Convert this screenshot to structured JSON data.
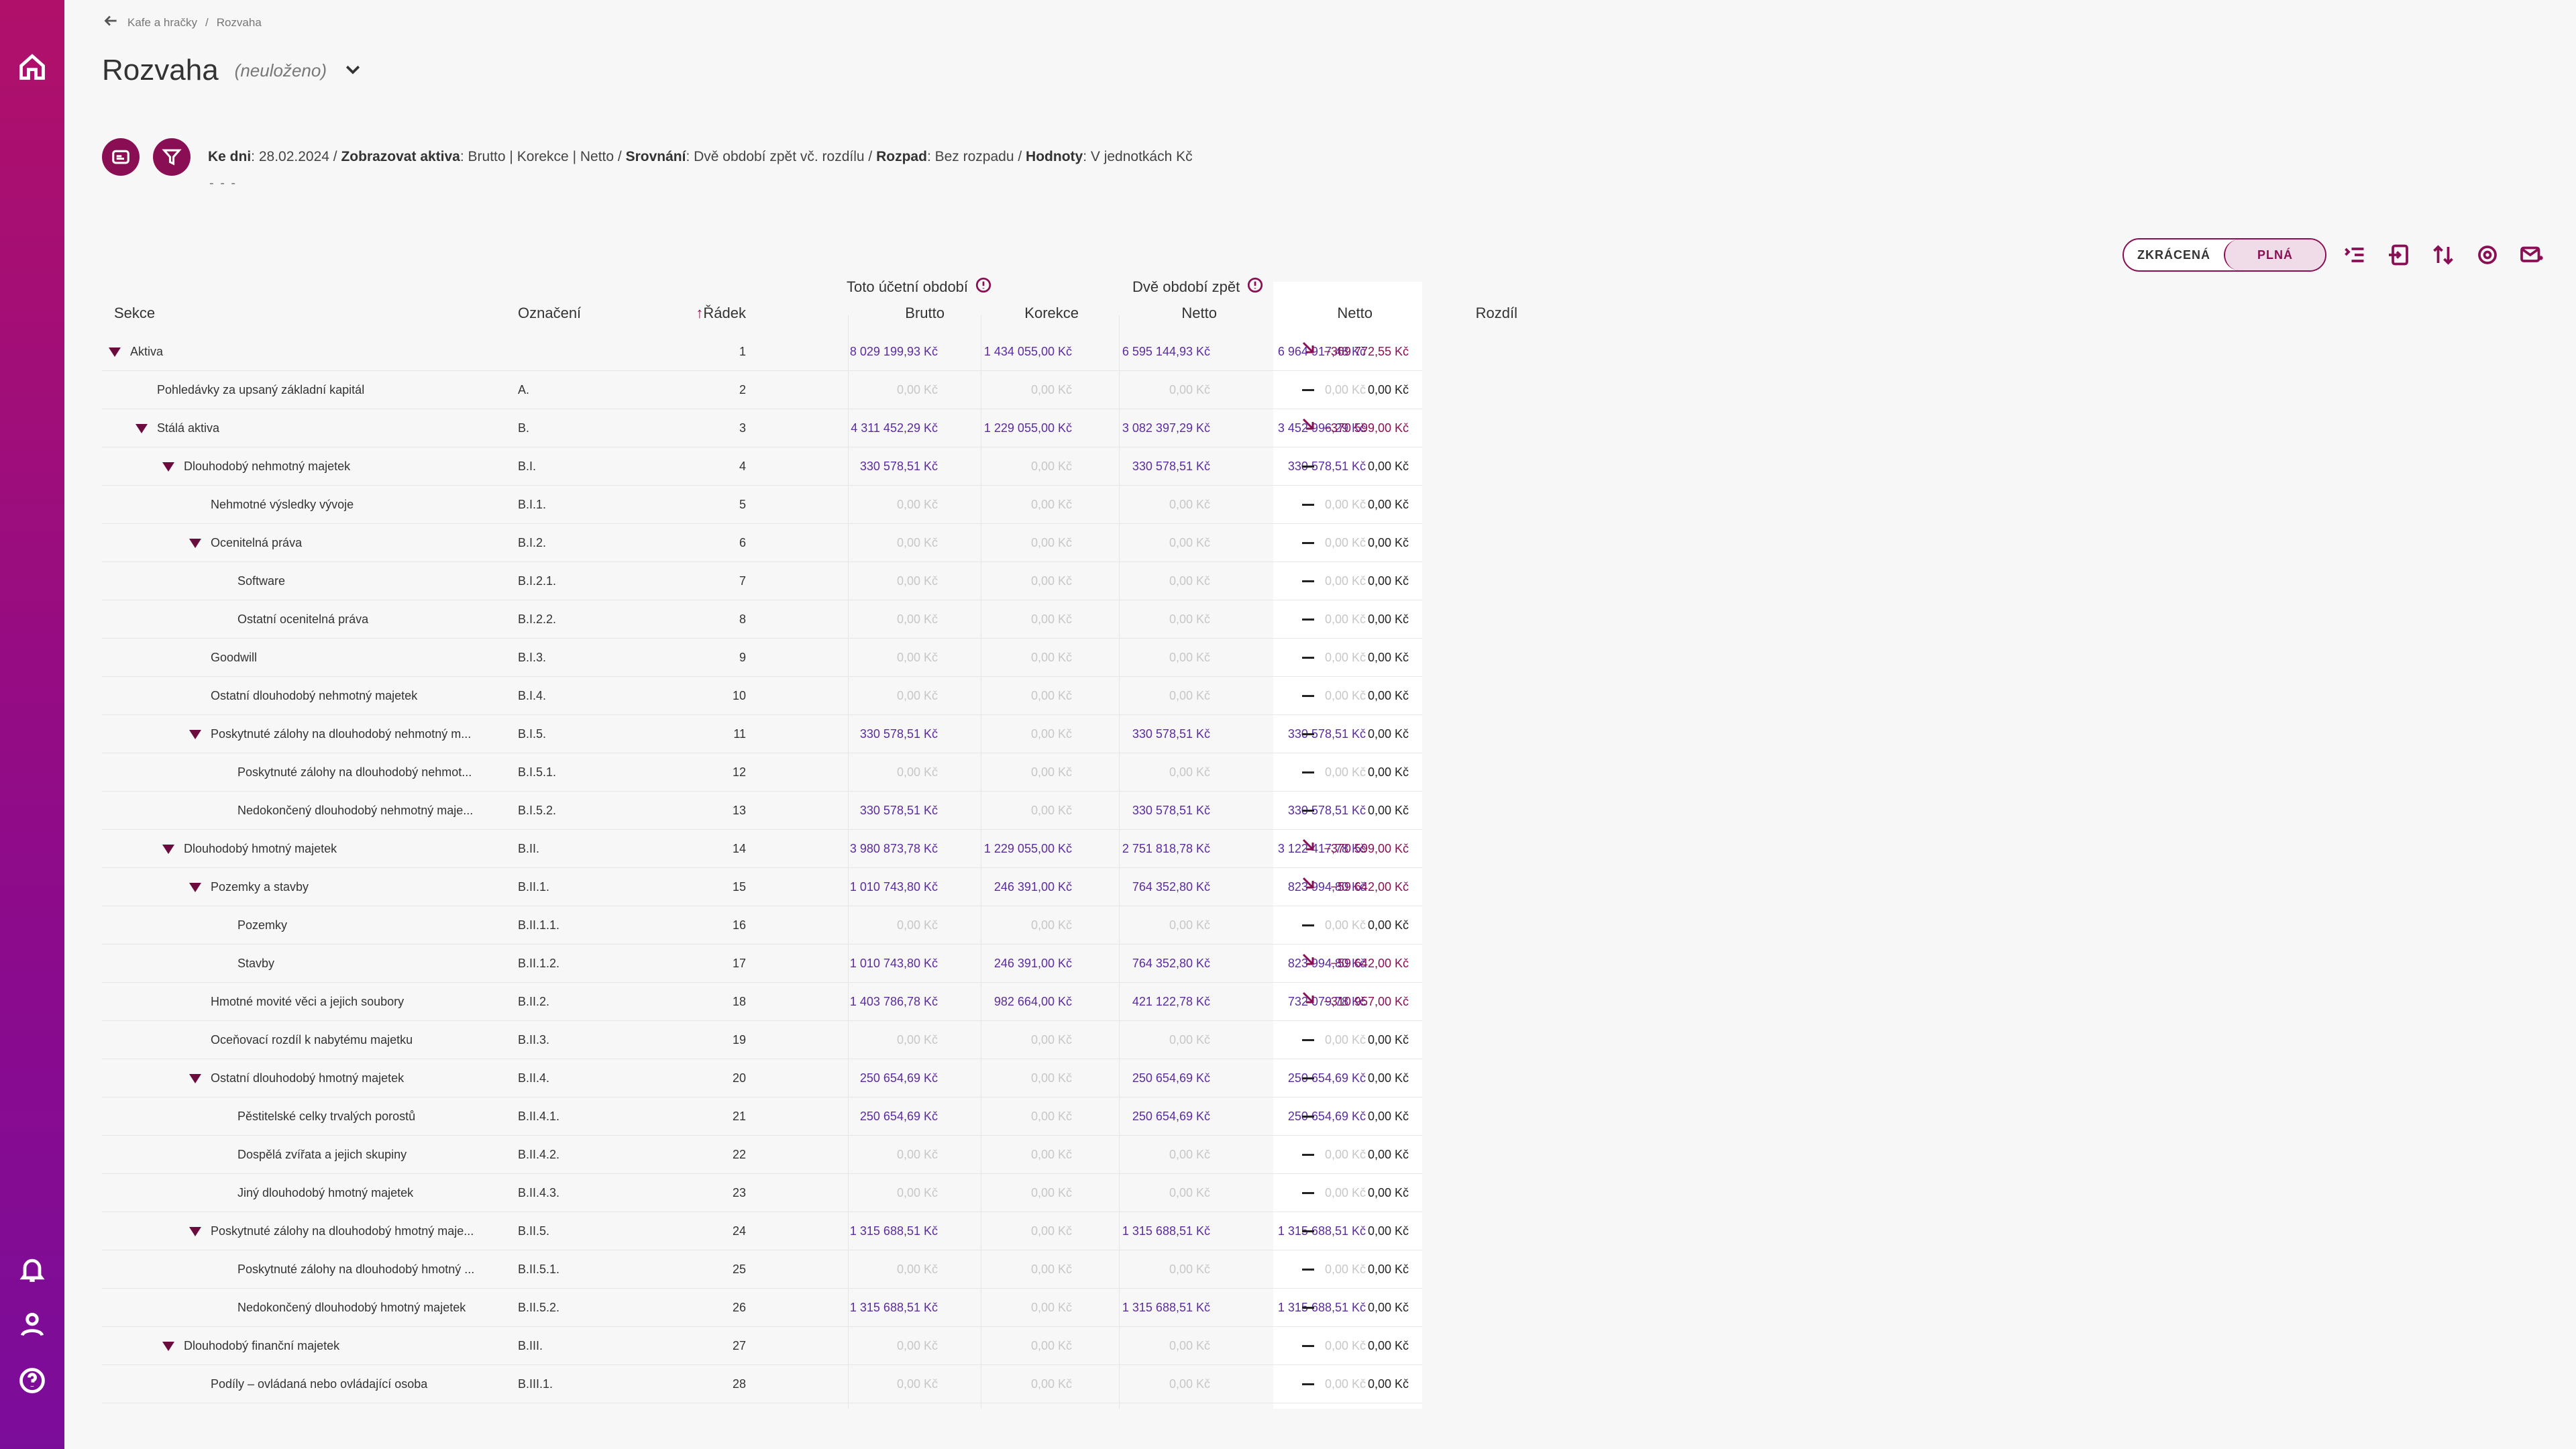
{
  "breadcrumb": {
    "company": "Kafe a hračky",
    "separator": "/",
    "page": "Rozvaha"
  },
  "title": "Rozvaha",
  "subtitle": "(neuloženo)",
  "filters": {
    "ke_dni_label": "Ke dni",
    "ke_dni_value": "28.02.2024",
    "zobrazovat_label": "Zobrazovat aktiva",
    "zobrazovat_value": "Brutto | Korekce | Netto",
    "srovnani_label": "Srovnání",
    "srovnani_value": "Dvě období zpět vč. rozdílu",
    "rozpad_label": "Rozpad",
    "rozpad_value": "Bez rozpadu",
    "hodnoty_label": "Hodnoty",
    "hodnoty_value": "V jednotkách Kč",
    "placeholder": "- - -"
  },
  "view_toggle": {
    "short": "ZKRÁCENÁ",
    "full": "PLNÁ",
    "selected": "full"
  },
  "group_headers": {
    "current": "Toto účetní období",
    "previous": "Dvě období zpět"
  },
  "columns": {
    "sekce": "Sekce",
    "oznaceni": "Označení",
    "radek": "Řádek",
    "brutto": "Brutto",
    "korekce": "Korekce",
    "netto": "Netto",
    "netto_prev": "Netto",
    "rozdil": "Rozdíl"
  },
  "colors": {
    "brand": "#8a0e54",
    "value": "#5b2ba0",
    "zero": "#c7c7c7"
  },
  "rows": [
    {
      "level": 0,
      "expand": true,
      "sekce": "Aktiva",
      "oznaceni": "",
      "radek": "1",
      "brutto": "8 029 199,93 Kč",
      "korekce": "1 434 055,00 Kč",
      "netto": "6 595 144,93 Kč",
      "netto_prev": "6 964 917,48 Kč",
      "trend": "down",
      "rozdil": "−369 772,55 Kč"
    },
    {
      "level": 1,
      "expand": false,
      "sekce": "Pohledávky za upsaný základní kapitál",
      "oznaceni": "A.",
      "radek": "2",
      "brutto": "0,00 Kč",
      "korekce": "0,00 Kč",
      "netto": "0,00 Kč",
      "netto_prev": "0,00 Kč",
      "trend": "flat",
      "rozdil": "0,00 Kč"
    },
    {
      "level": 1,
      "expand": true,
      "sekce": "Stálá aktiva",
      "oznaceni": "B.",
      "radek": "3",
      "brutto": "4 311 452,29 Kč",
      "korekce": "1 229 055,00 Kč",
      "netto": "3 082 397,29 Kč",
      "netto_prev": "3 452 996,29 Kč",
      "trend": "down",
      "rozdil": "−370 599,00 Kč"
    },
    {
      "level": 2,
      "expand": true,
      "sekce": "Dlouhodobý nehmotný majetek",
      "oznaceni": "B.I.",
      "radek": "4",
      "brutto": "330 578,51 Kč",
      "korekce": "0,00 Kč",
      "netto": "330 578,51 Kč",
      "netto_prev": "330 578,51 Kč",
      "trend": "flat",
      "rozdil": "0,00 Kč"
    },
    {
      "level": 3,
      "expand": false,
      "sekce": "Nehmotné výsledky vývoje",
      "oznaceni": "B.I.1.",
      "radek": "5",
      "brutto": "0,00 Kč",
      "korekce": "0,00 Kč",
      "netto": "0,00 Kč",
      "netto_prev": "0,00 Kč",
      "trend": "flat",
      "rozdil": "0,00 Kč"
    },
    {
      "level": 3,
      "expand": true,
      "sekce": "Ocenitelná práva",
      "oznaceni": "B.I.2.",
      "radek": "6",
      "brutto": "0,00 Kč",
      "korekce": "0,00 Kč",
      "netto": "0,00 Kč",
      "netto_prev": "0,00 Kč",
      "trend": "flat",
      "rozdil": "0,00 Kč"
    },
    {
      "level": 4,
      "expand": false,
      "sekce": "Software",
      "oznaceni": "B.I.2.1.",
      "radek": "7",
      "brutto": "0,00 Kč",
      "korekce": "0,00 Kč",
      "netto": "0,00 Kč",
      "netto_prev": "0,00 Kč",
      "trend": "flat",
      "rozdil": "0,00 Kč"
    },
    {
      "level": 4,
      "expand": false,
      "sekce": "Ostatní ocenitelná práva",
      "oznaceni": "B.I.2.2.",
      "radek": "8",
      "brutto": "0,00 Kč",
      "korekce": "0,00 Kč",
      "netto": "0,00 Kč",
      "netto_prev": "0,00 Kč",
      "trend": "flat",
      "rozdil": "0,00 Kč"
    },
    {
      "level": 3,
      "expand": false,
      "sekce": "Goodwill",
      "oznaceni": "B.I.3.",
      "radek": "9",
      "brutto": "0,00 Kč",
      "korekce": "0,00 Kč",
      "netto": "0,00 Kč",
      "netto_prev": "0,00 Kč",
      "trend": "flat",
      "rozdil": "0,00 Kč"
    },
    {
      "level": 3,
      "expand": false,
      "sekce": "Ostatní dlouhodobý nehmotný majetek",
      "oznaceni": "B.I.4.",
      "radek": "10",
      "brutto": "0,00 Kč",
      "korekce": "0,00 Kč",
      "netto": "0,00 Kč",
      "netto_prev": "0,00 Kč",
      "trend": "flat",
      "rozdil": "0,00 Kč"
    },
    {
      "level": 3,
      "expand": true,
      "sekce": "Poskytnuté zálohy na dlouhodobý nehmotný m...",
      "oznaceni": "B.I.5.",
      "radek": "11",
      "brutto": "330 578,51 Kč",
      "korekce": "0,00 Kč",
      "netto": "330 578,51 Kč",
      "netto_prev": "330 578,51 Kč",
      "trend": "flat",
      "rozdil": "0,00 Kč"
    },
    {
      "level": 4,
      "expand": false,
      "sekce": "Poskytnuté zálohy na dlouhodobý nehmot...",
      "oznaceni": "B.I.5.1.",
      "radek": "12",
      "brutto": "0,00 Kč",
      "korekce": "0,00 Kč",
      "netto": "0,00 Kč",
      "netto_prev": "0,00 Kč",
      "trend": "flat",
      "rozdil": "0,00 Kč"
    },
    {
      "level": 4,
      "expand": false,
      "sekce": "Nedokončený dlouhodobý nehmotný maje...",
      "oznaceni": "B.I.5.2.",
      "radek": "13",
      "brutto": "330 578,51 Kč",
      "korekce": "0,00 Kč",
      "netto": "330 578,51 Kč",
      "netto_prev": "330 578,51 Kč",
      "trend": "flat",
      "rozdil": "0,00 Kč"
    },
    {
      "level": 2,
      "expand": true,
      "sekce": "Dlouhodobý hmotný majetek",
      "oznaceni": "B.II.",
      "radek": "14",
      "brutto": "3 980 873,78 Kč",
      "korekce": "1 229 055,00 Kč",
      "netto": "2 751 818,78 Kč",
      "netto_prev": "3 122 417,78 Kč",
      "trend": "down",
      "rozdil": "−370 599,00 Kč"
    },
    {
      "level": 3,
      "expand": true,
      "sekce": "Pozemky a stavby",
      "oznaceni": "B.II.1.",
      "radek": "15",
      "brutto": "1 010 743,80 Kč",
      "korekce": "246 391,00 Kč",
      "netto": "764 352,80 Kč",
      "netto_prev": "823 994,80 Kč",
      "trend": "down",
      "rozdil": "−59 642,00 Kč"
    },
    {
      "level": 4,
      "expand": false,
      "sekce": "Pozemky",
      "oznaceni": "B.II.1.1.",
      "radek": "16",
      "brutto": "0,00 Kč",
      "korekce": "0,00 Kč",
      "netto": "0,00 Kč",
      "netto_prev": "0,00 Kč",
      "trend": "flat",
      "rozdil": "0,00 Kč"
    },
    {
      "level": 4,
      "expand": false,
      "sekce": "Stavby",
      "oznaceni": "B.II.1.2.",
      "radek": "17",
      "brutto": "1 010 743,80 Kč",
      "korekce": "246 391,00 Kč",
      "netto": "764 352,80 Kč",
      "netto_prev": "823 994,80 Kč",
      "trend": "down",
      "rozdil": "−59 642,00 Kč"
    },
    {
      "level": 3,
      "expand": false,
      "sekce": "Hmotné movité věci a jejich soubory",
      "oznaceni": "B.II.2.",
      "radek": "18",
      "brutto": "1 403 786,78 Kč",
      "korekce": "982 664,00 Kč",
      "netto": "421 122,78 Kč",
      "netto_prev": "732 079,78 Kč",
      "trend": "down",
      "rozdil": "−310 957,00 Kč"
    },
    {
      "level": 3,
      "expand": false,
      "sekce": "Oceňovací rozdíl k nabytému majetku",
      "oznaceni": "B.II.3.",
      "radek": "19",
      "brutto": "0,00 Kč",
      "korekce": "0,00 Kč",
      "netto": "0,00 Kč",
      "netto_prev": "0,00 Kč",
      "trend": "flat",
      "rozdil": "0,00 Kč"
    },
    {
      "level": 3,
      "expand": true,
      "sekce": "Ostatní dlouhodobý hmotný majetek",
      "oznaceni": "B.II.4.",
      "radek": "20",
      "brutto": "250 654,69 Kč",
      "korekce": "0,00 Kč",
      "netto": "250 654,69 Kč",
      "netto_prev": "250 654,69 Kč",
      "trend": "flat",
      "rozdil": "0,00 Kč"
    },
    {
      "level": 4,
      "expand": false,
      "sekce": "Pěstitelské celky trvalých porostů",
      "oznaceni": "B.II.4.1.",
      "radek": "21",
      "brutto": "250 654,69 Kč",
      "korekce": "0,00 Kč",
      "netto": "250 654,69 Kč",
      "netto_prev": "250 654,69 Kč",
      "trend": "flat",
      "rozdil": "0,00 Kč"
    },
    {
      "level": 4,
      "expand": false,
      "sekce": "Dospělá zvířata a jejich skupiny",
      "oznaceni": "B.II.4.2.",
      "radek": "22",
      "brutto": "0,00 Kč",
      "korekce": "0,00 Kč",
      "netto": "0,00 Kč",
      "netto_prev": "0,00 Kč",
      "trend": "flat",
      "rozdil": "0,00 Kč"
    },
    {
      "level": 4,
      "expand": false,
      "sekce": "Jiný dlouhodobý hmotný majetek",
      "oznaceni": "B.II.4.3.",
      "radek": "23",
      "brutto": "0,00 Kč",
      "korekce": "0,00 Kč",
      "netto": "0,00 Kč",
      "netto_prev": "0,00 Kč",
      "trend": "flat",
      "rozdil": "0,00 Kč"
    },
    {
      "level": 3,
      "expand": true,
      "sekce": "Poskytnuté zálohy na dlouhodobý hmotný maje...",
      "oznaceni": "B.II.5.",
      "radek": "24",
      "brutto": "1 315 688,51 Kč",
      "korekce": "0,00 Kč",
      "netto": "1 315 688,51 Kč",
      "netto_prev": "1 315 688,51 Kč",
      "trend": "flat",
      "rozdil": "0,00 Kč"
    },
    {
      "level": 4,
      "expand": false,
      "sekce": "Poskytnuté zálohy na dlouhodobý hmotný ...",
      "oznaceni": "B.II.5.1.",
      "radek": "25",
      "brutto": "0,00 Kč",
      "korekce": "0,00 Kč",
      "netto": "0,00 Kč",
      "netto_prev": "0,00 Kč",
      "trend": "flat",
      "rozdil": "0,00 Kč"
    },
    {
      "level": 4,
      "expand": false,
      "sekce": "Nedokončený dlouhodobý hmotný majetek",
      "oznaceni": "B.II.5.2.",
      "radek": "26",
      "brutto": "1 315 688,51 Kč",
      "korekce": "0,00 Kč",
      "netto": "1 315 688,51 Kč",
      "netto_prev": "1 315 688,51 Kč",
      "trend": "flat",
      "rozdil": "0,00 Kč"
    },
    {
      "level": 2,
      "expand": true,
      "sekce": "Dlouhodobý finanční majetek",
      "oznaceni": "B.III.",
      "radek": "27",
      "brutto": "0,00 Kč",
      "korekce": "0,00 Kč",
      "netto": "0,00 Kč",
      "netto_prev": "0,00 Kč",
      "trend": "flat",
      "rozdil": "0,00 Kč"
    },
    {
      "level": 3,
      "expand": false,
      "sekce": "Podíly – ovládaná nebo ovládající osoba",
      "oznaceni": "B.III.1.",
      "radek": "28",
      "brutto": "0,00 Kč",
      "korekce": "0,00 Kč",
      "netto": "0,00 Kč",
      "netto_prev": "0,00 Kč",
      "trend": "flat",
      "rozdil": "0,00 Kč"
    }
  ]
}
